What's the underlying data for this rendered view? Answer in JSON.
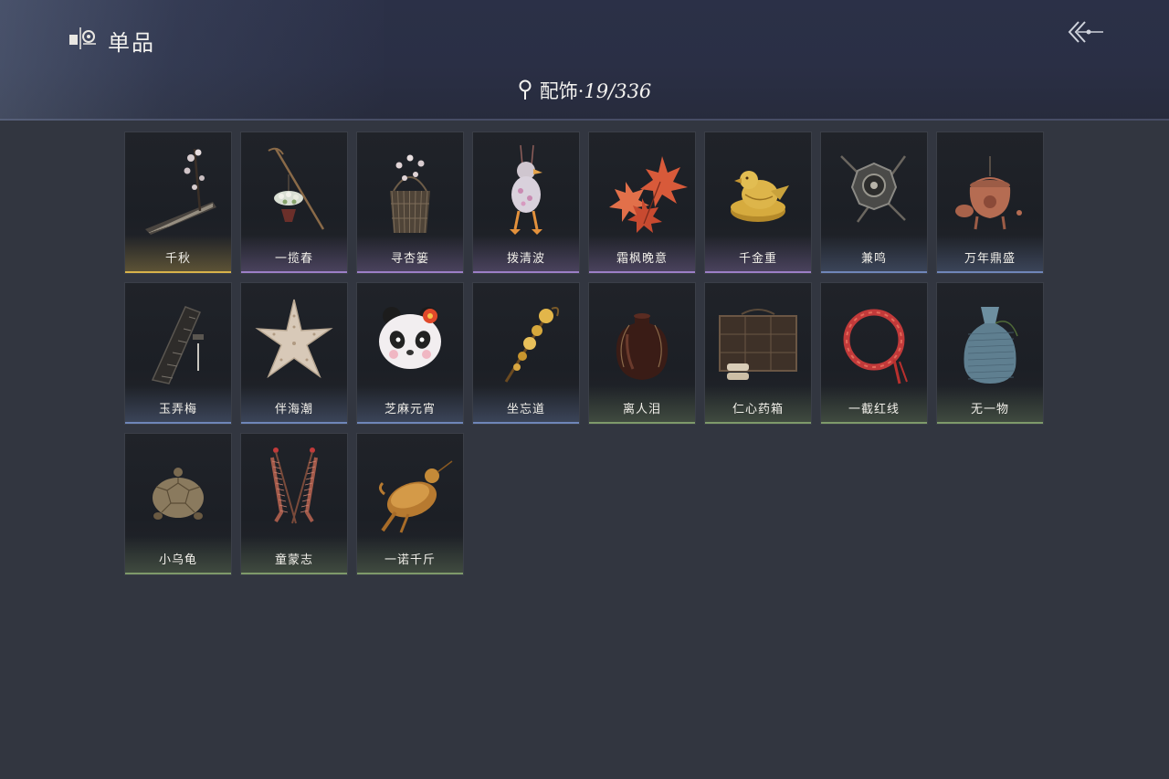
{
  "header": {
    "title": "单品",
    "category_label": "配饰",
    "separator": "·",
    "collected": "19",
    "total": "336",
    "icons": [
      "collection-icon",
      "back-arrow-icon",
      "location-pin-icon"
    ]
  },
  "rarity_colors": {
    "gold": "#d8b24a",
    "purple": "#9c7fc6",
    "blue": "#6f86b8",
    "green": "#7e9a6a"
  },
  "items": [
    {
      "name": "千秋",
      "rarity": "gold",
      "icon": "guqin-icon"
    },
    {
      "name": "一揽春",
      "rarity": "purple",
      "icon": "flower-basket-icon"
    },
    {
      "name": "寻杏篓",
      "rarity": "purple",
      "icon": "basket-icon"
    },
    {
      "name": "拨清波",
      "rarity": "purple",
      "icon": "duck-toy-icon"
    },
    {
      "name": "霜枫晚意",
      "rarity": "purple",
      "icon": "maple-leaf-icon"
    },
    {
      "name": "千金重",
      "rarity": "purple",
      "icon": "golden-bird-icon"
    },
    {
      "name": "兼鸣",
      "rarity": "blue",
      "icon": "shield-icon"
    },
    {
      "name": "万年鼎盛",
      "rarity": "blue",
      "icon": "cauldron-icon"
    },
    {
      "name": "玉弄梅",
      "rarity": "blue",
      "icon": "flute-case-icon"
    },
    {
      "name": "伴海潮",
      "rarity": "blue",
      "icon": "starfish-icon"
    },
    {
      "name": "芝麻元宵",
      "rarity": "blue",
      "icon": "panda-head-icon"
    },
    {
      "name": "坐忘道",
      "rarity": "blue",
      "icon": "golden-staff-icon"
    },
    {
      "name": "离人泪",
      "rarity": "green",
      "icon": "jar-icon"
    },
    {
      "name": "仁心药箱",
      "rarity": "green",
      "icon": "medicine-box-icon"
    },
    {
      "name": "一截红线",
      "rarity": "green",
      "icon": "red-rope-icon"
    },
    {
      "name": "无一物",
      "rarity": "green",
      "icon": "cloth-bag-icon"
    },
    {
      "name": "小乌龟",
      "rarity": "green",
      "icon": "turtle-icon"
    },
    {
      "name": "童蒙志",
      "rarity": "green",
      "icon": "tassel-ornament-icon"
    },
    {
      "name": "一诺千斤",
      "rarity": "green",
      "icon": "roast-bird-icon"
    }
  ]
}
